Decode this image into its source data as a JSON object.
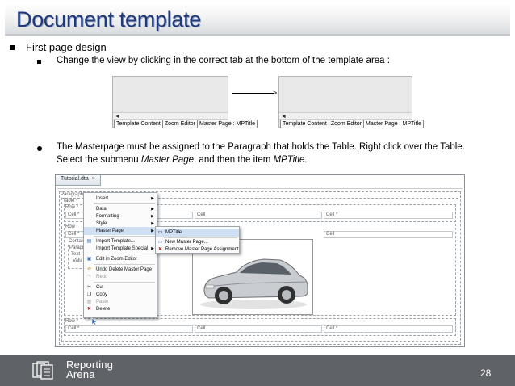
{
  "slide": {
    "title": "Document template",
    "bullet1": "First page design",
    "sub1": "Change the view by clicking in the correct tab at the bottom of the template area :",
    "bullet2_line1": "The Masterpage must be assigned to the Paragraph that holds the Table. Right click over the Table.",
    "bullet2_pre": "Select the submenu ",
    "bullet2_em1": "Master Page",
    "bullet2_mid": ", and then the item ",
    "bullet2_em2": "MPTitle",
    "bullet2_end": ".",
    "page_number": "28",
    "brand_line1": "Reporting",
    "brand_line2": "Arena"
  },
  "tabs_left": {
    "tab1": "Template Content",
    "tab2": "Zoom Editor",
    "tab3": "Master Page : MPTitle"
  },
  "tabs_right": {
    "tab1": "Template Content",
    "tab2": "Zoom Editor",
    "tab3": "Master Page : MPTitle"
  },
  "editor": {
    "tab_title": "Tutorial.dta",
    "paragraph": "Paragraph *",
    "table": "Table *",
    "row1": "Row *",
    "row2": "Row",
    "row3": "Row *",
    "cell_star": "Cell *",
    "cell": "Cell",
    "container": "Container",
    "paragraph2": "Paragr",
    "text": "Text",
    "value": "Valu"
  },
  "context_menu": {
    "insert": "Insert",
    "data": "Data",
    "formatting": "Formatting",
    "style": "Style",
    "master_page": "Master Page",
    "import_template": "Import Template...",
    "import_template_special": "Import Template Special",
    "edit_zoom": "Edit in Zoom Editor",
    "undo": "Undo Delete Master Page",
    "redo": "Redo",
    "cut": "Cut",
    "copy": "Copy",
    "paste": "Paste",
    "delete": "Delete"
  },
  "submenu": {
    "mptitle": "MPTitle",
    "new_master_page": "New Master Page...",
    "remove_assignment": "Remove Master Page Assignment"
  },
  "icons": {
    "bullet": "square-bullet",
    "scroll_left": "arrow-left-icon",
    "arrow": "long-arrow-right-icon",
    "car": "car-image",
    "logo": "reporting-arena-logo"
  },
  "colors": {
    "title": "#1f3a7a",
    "footer": "#5f6368",
    "highlight": "#cfe0f5"
  }
}
